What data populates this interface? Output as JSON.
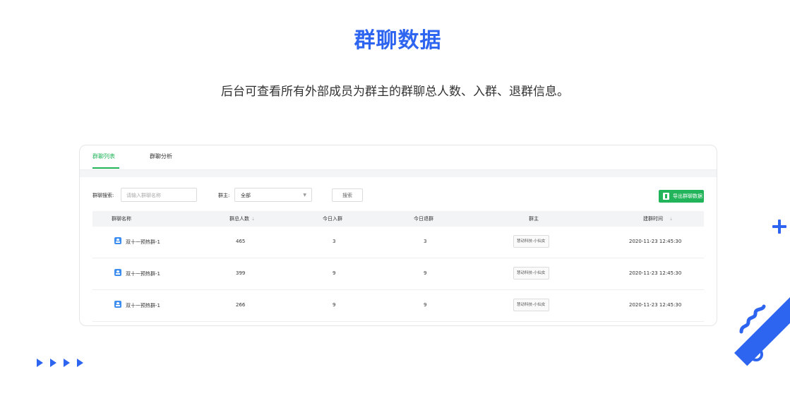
{
  "page": {
    "title": "群聊数据",
    "subtitle": "后台可查看所有外部成员为群主的群聊总人数、入群、退群信息。"
  },
  "tabs": [
    {
      "label": "群聊列表",
      "active": true
    },
    {
      "label": "群聊分析",
      "active": false
    }
  ],
  "filters": {
    "search_label": "群聊搜索:",
    "search_placeholder": "请输入群聊名称",
    "owner_label": "群主:",
    "owner_selected": "全部",
    "search_button": "搜索",
    "export_button": "导出群聊数据"
  },
  "table": {
    "columns": [
      "群聊名称",
      "群总人数",
      "今日入群",
      "今日退群",
      "群主",
      "建群时间"
    ],
    "rows": [
      {
        "name": "双十一预热群-1",
        "total": "465",
        "joined": "3",
        "left": "3",
        "owner": "慧动科技-小仙女",
        "created": "2020-11-23 12:45:30"
      },
      {
        "name": "双十一预热群-1",
        "total": "399",
        "joined": "9",
        "left": "9",
        "owner": "慧动科技-小仙女",
        "created": "2020-11-23 12:45:30"
      },
      {
        "name": "双十一预热群-1",
        "total": "266",
        "joined": "9",
        "left": "9",
        "owner": "慧动科技-小仙女",
        "created": "2020-11-23 12:45:30"
      }
    ]
  },
  "colors": {
    "accent_blue": "#2d64f0",
    "accent_green": "#22b45a"
  },
  "icons": {
    "group": "group-chat-icon",
    "export": "export-file-icon",
    "sort": "sort-arrow-icon",
    "dropdown": "chevron-down-icon"
  }
}
